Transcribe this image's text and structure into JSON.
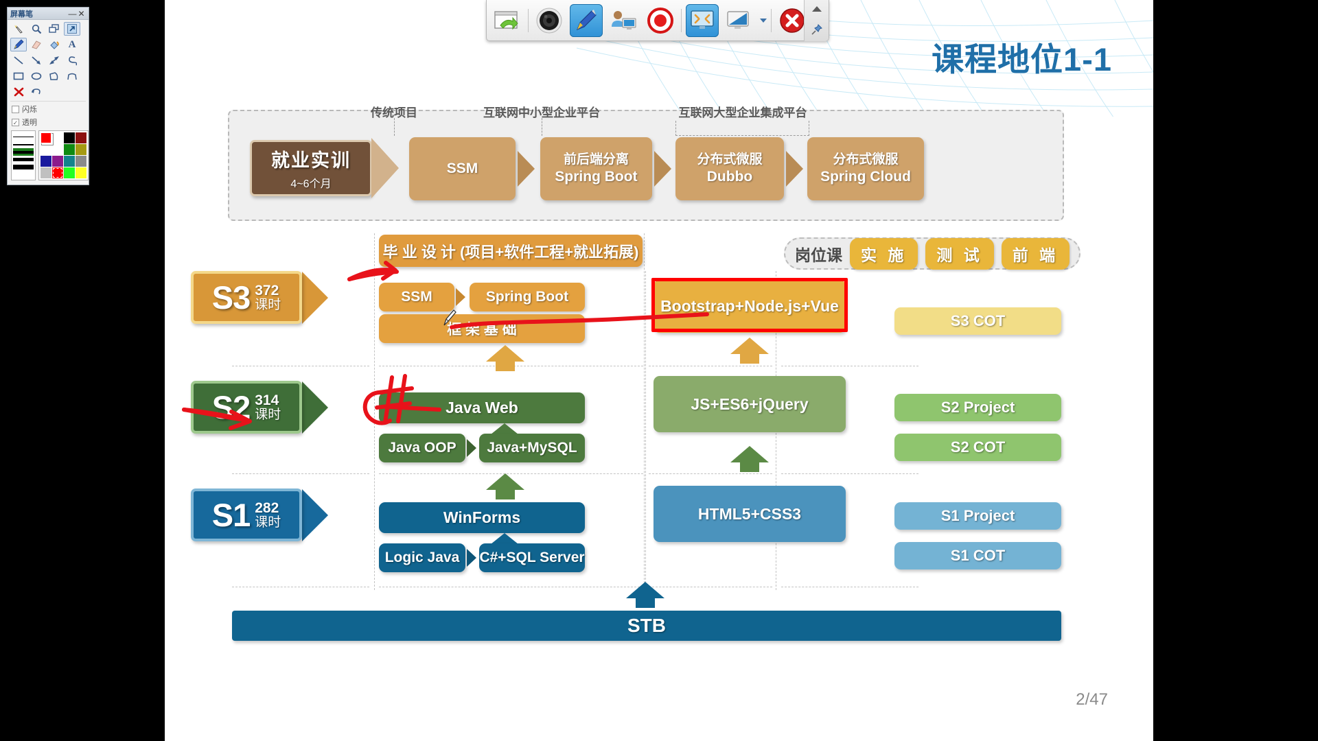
{
  "slide": {
    "title": "课程地位1-1",
    "page_number": "2/47"
  },
  "top_band": {
    "captions": [
      {
        "text": "传统项目"
      },
      {
        "text": "互联网中小型企业平台"
      },
      {
        "text": "互联网大型企业集成平台"
      }
    ],
    "employment": {
      "line1": "就业实训",
      "line2": "4~6个月"
    },
    "boxes": [
      {
        "t1": "",
        "t2": "SSM"
      },
      {
        "t1": "前后端分离",
        "t2": "Spring Boot"
      },
      {
        "t1": "分布式微服",
        "t2": "Dubbo"
      },
      {
        "t1": "分布式微服",
        "t2": "Spring Cloud"
      }
    ]
  },
  "job_group": {
    "label": "岗位课",
    "pills": [
      "实 施",
      "测 试",
      "前 端"
    ]
  },
  "graduation": {
    "label": "毕 业 设 计 (项目+软件工程+就业拓展)"
  },
  "stages": [
    {
      "name": "S3",
      "hours": "372",
      "unit": "课时",
      "color": "#d89738",
      "frame": "#f4d88a"
    },
    {
      "name": "S2",
      "hours": "314",
      "unit": "课时",
      "color": "#3f6e38",
      "frame": "#9ec98d"
    },
    {
      "name": "S1",
      "hours": "282",
      "unit": "课时",
      "color": "#17699c",
      "frame": "#7fb6d6"
    }
  ],
  "middle_column": {
    "s3": {
      "row_small": [
        {
          "label": "SSM"
        },
        {
          "label": "Spring Boot"
        }
      ],
      "row_wide": {
        "label": "框 架 基 础"
      }
    },
    "s2": {
      "row_wide": {
        "label": "Java Web"
      },
      "row_small": [
        {
          "label": "Java OOP"
        },
        {
          "label": "Java+MySQL"
        }
      ]
    },
    "s1": {
      "row_wide": {
        "label": "WinForms"
      },
      "row_small": [
        {
          "label": "Logic Java"
        },
        {
          "label": "C#+SQL Server"
        }
      ]
    }
  },
  "right_column": {
    "s3": {
      "label": "Bootstrap+Node.js+Vue",
      "highlighted": true
    },
    "s2": {
      "label": "JS+ES6+jQuery"
    },
    "s1": {
      "label": "HTML5+CSS3"
    }
  },
  "far_right_column": {
    "s3": [
      {
        "label": "S3 COT"
      }
    ],
    "s2": [
      {
        "label": "S2 Project"
      },
      {
        "label": "S2 COT"
      }
    ],
    "s1": [
      {
        "label": "S1 Project"
      },
      {
        "label": "S1 COT"
      }
    ]
  },
  "foundation": {
    "label": "STB"
  },
  "colors": {
    "title_blue": "#1f6fa8",
    "orange": "#e09b3d",
    "gold": "#e8b040",
    "green": "#4d7a3e",
    "green_light": "#8aab6b",
    "blue": "#10648f",
    "blue_light": "#4b93bd",
    "highlight_red": "#ff0000",
    "ink_red": "#e8121a",
    "band_bg": "#efefef",
    "tan": "#cfa26a",
    "brown": "#715139"
  },
  "pen_window": {
    "title": "屏幕笔",
    "minimize": "—",
    "close": "✕",
    "tool_rows": [
      [
        "magic-select-icon",
        "zoom-icon",
        "shape-copy-icon",
        "arrow-out-icon"
      ],
      [
        "pencil-icon",
        "eraser-icon",
        "fill-icon",
        "text-icon"
      ],
      [
        "line-icon",
        "arrow-icon",
        "double-arrow-icon",
        "curve-icon"
      ],
      [
        "rect-icon",
        "ellipse-icon",
        "polygon-icon",
        "freeform-icon"
      ],
      [
        "delete-icon",
        "undo-icon"
      ]
    ],
    "checkboxes": [
      {
        "label": "闪烁",
        "checked": false
      },
      {
        "label": "透明",
        "checked": true
      }
    ],
    "selected_tool": "pencil-icon",
    "selected_width_index": 2,
    "palette": [
      "#000000",
      "#8c1010",
      "#0f8a12",
      "#a59a12",
      "#1a1a9e",
      "#8c1b8c",
      "#12838c",
      "#8a8a8a",
      "#c0c0c0",
      "#ff0000",
      "#22ff22",
      "#ffff22"
    ],
    "current_color": "#ff0000"
  },
  "record_toolbar": {
    "buttons": [
      {
        "name": "restore-window-icon",
        "active": false
      },
      {
        "name": "webcam-icon",
        "active": false
      },
      {
        "name": "pen-icon",
        "active": true
      },
      {
        "name": "presenter-icon",
        "active": false
      },
      {
        "name": "record-icon",
        "active": false
      },
      {
        "name": "fullscreen-icon",
        "active": true
      },
      {
        "name": "screen-region-icon",
        "active": false
      },
      {
        "name": "stop-close-icon",
        "active": false
      }
    ],
    "side": {
      "collapse": "collapse-icon",
      "pin": "pin-icon"
    }
  }
}
